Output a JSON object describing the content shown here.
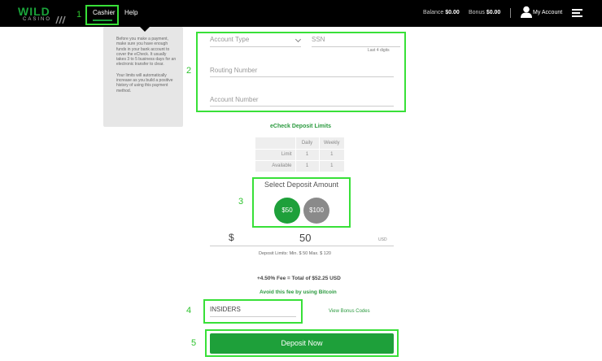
{
  "header": {
    "logo_top": "WILD",
    "logo_bottom": "CASINO",
    "nav": {
      "cashier": "Cashier",
      "help": "Help"
    },
    "balance_label": "Balance",
    "balance_value": "$0.00",
    "bonus_label": "Bonus",
    "bonus_value": "$0.00",
    "account": "My Account"
  },
  "tooltip": {
    "para1": "Before you make a payment, make sure you have enough funds in your bank account to cover the eCheck. It usually takes 3 to 5 business days for an electronic transfer to clear.",
    "para2": "Your limits will automatically increase as you build a positive history of using this payment method."
  },
  "form": {
    "account_type": "Account Type",
    "ssn": "SSN",
    "ssn_hint": "Last 4 digits",
    "routing": "Routing Number",
    "account_number": "Account Number"
  },
  "limits": {
    "title": "eCheck Deposit Limits",
    "headers": [
      "",
      "Daily",
      "Weekly"
    ],
    "rows": [
      [
        "Limit",
        "1",
        "1"
      ],
      [
        "Available",
        "1",
        "1"
      ]
    ]
  },
  "deposit": {
    "title": "Select Deposit Amount",
    "options": [
      "$50",
      "$100"
    ],
    "currency_symbol": "$",
    "amount": "50",
    "currency": "USD",
    "limits_text": "Deposit Limits: Min. $ 50   Max. $ 120",
    "fee_text": "+4.50% Fee = Total of $52.25 USD",
    "avoid_text": "Avoid this fee by using Bitcoin",
    "bonus_code": "INSIDERS",
    "view_bonus": "View Bonus Codes",
    "submit": "Deposit Now"
  },
  "annotations": [
    "1",
    "2",
    "3",
    "4",
    "5"
  ],
  "colors": {
    "accent": "#1ea03a",
    "highlight": "#38e038",
    "secondary_button": "#8a8a8a"
  }
}
